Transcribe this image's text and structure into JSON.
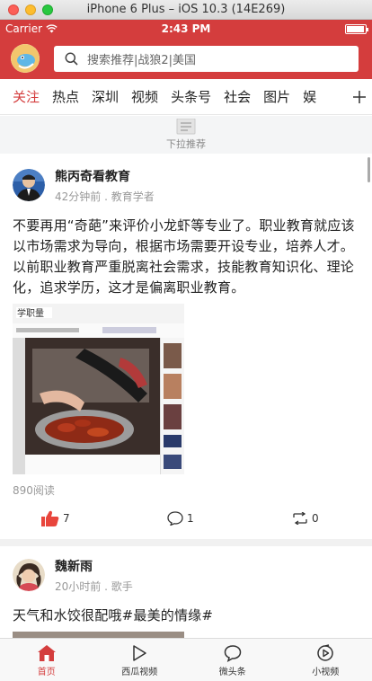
{
  "simulator": {
    "title": "iPhone 6 Plus – iOS 10.3 (14E269)"
  },
  "status_bar": {
    "carrier": "Carrier",
    "time": "2:43 PM"
  },
  "search": {
    "placeholder": "搜索推荐|战狼2|美国"
  },
  "tabs": [
    "关注",
    "热点",
    "深圳",
    "视频",
    "头条号",
    "社会",
    "图片",
    "娱"
  ],
  "active_tab": "关注",
  "pull_refresh": {
    "label": "下拉推荐"
  },
  "posts": [
    {
      "author": "熊丙奇看教育",
      "meta": "42分钟前 . 教育学者",
      "text": "不要再用“奇葩”来评价小龙虾等专业了。职业教育就应该以市场需求为导向，根据市场需要开设专业，培养人才。以前职业教育严重脱离社会需求，技能教育知识化、理论化，追求学历，这才是偏离职业教育。",
      "image_caption": "学职量",
      "reads": "890阅读",
      "likes": "7",
      "comments": "1",
      "shares": "0"
    },
    {
      "author": "魏新雨",
      "meta": "20小时前 . 歌手",
      "text": "天气和水饺很配哦#最美的情缘#"
    }
  ],
  "tabbar": [
    {
      "label": "首页",
      "icon": "home-icon",
      "active": true
    },
    {
      "label": "西瓜视频",
      "icon": "play-icon",
      "active": false
    },
    {
      "label": "微头条",
      "icon": "chat-bubble-icon",
      "active": false
    },
    {
      "label": "小视频",
      "icon": "small-video-icon",
      "active": false
    }
  ],
  "colors": {
    "brand_red": "#d43d3d",
    "like_red": "#e8453c"
  }
}
